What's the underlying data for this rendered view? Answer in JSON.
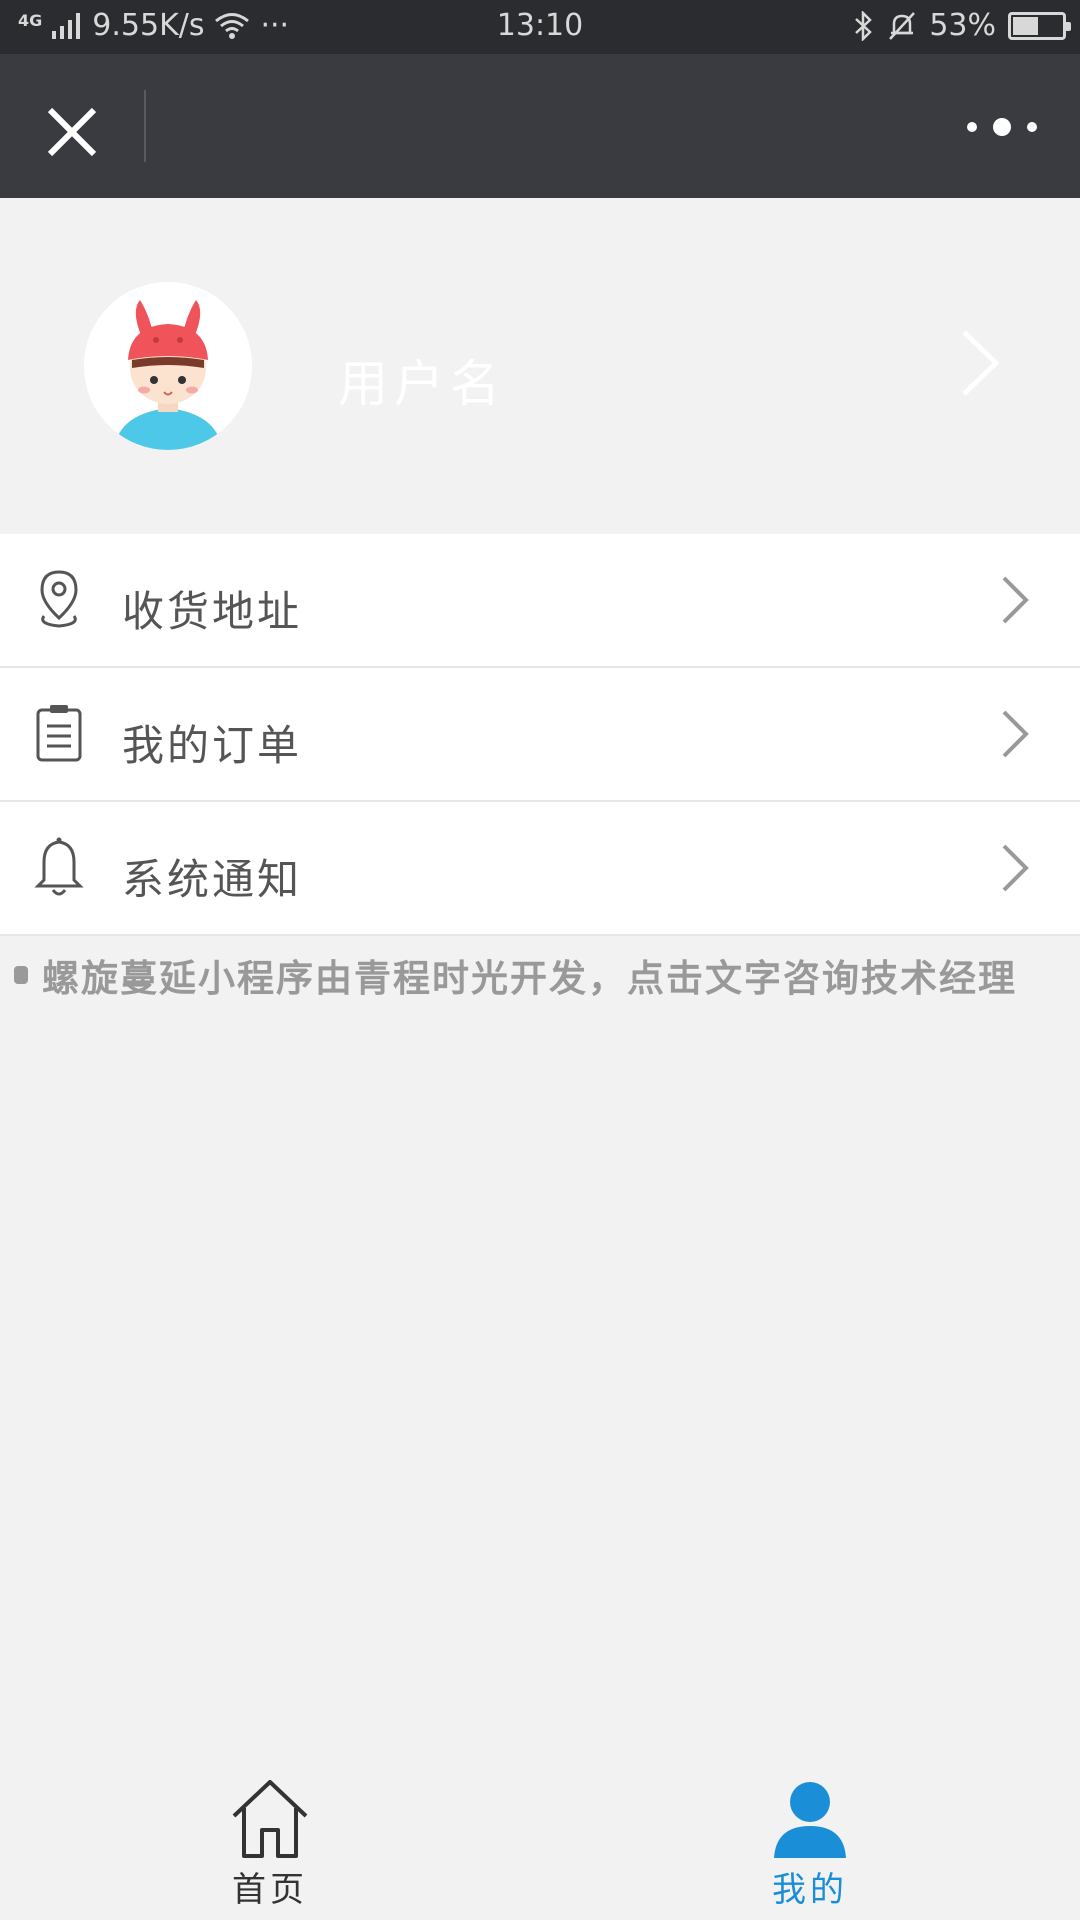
{
  "status_bar": {
    "network": "4G",
    "speed": "9.55K/s",
    "dots": "···",
    "time": "13:10",
    "battery_percent": "53%",
    "battery_level": 0.53
  },
  "profile": {
    "username": "用户名"
  },
  "menu": {
    "items": [
      {
        "label": "收货地址",
        "icon": "location-pin-icon"
      },
      {
        "label": "我的订单",
        "icon": "clipboard-list-icon"
      },
      {
        "label": "系统通知",
        "icon": "bell-icon"
      }
    ]
  },
  "notice": {
    "text": "螺旋蔓延小程序由青程时光开发，点击文字咨询技术经理"
  },
  "tabbar": {
    "tabs": [
      {
        "label": "首页",
        "icon": "home-icon",
        "active": false
      },
      {
        "label": "我的",
        "icon": "user-icon",
        "active": true
      }
    ]
  },
  "colors": {
    "navbar": "#3a3b40",
    "status_bar": "#2b2c30",
    "background": "#f2f2f2",
    "active_tab": "#1a8fd8",
    "inactive_tab": "#333333",
    "avatar_hat": "#f0545a",
    "avatar_shirt": "#4dc8e8"
  }
}
